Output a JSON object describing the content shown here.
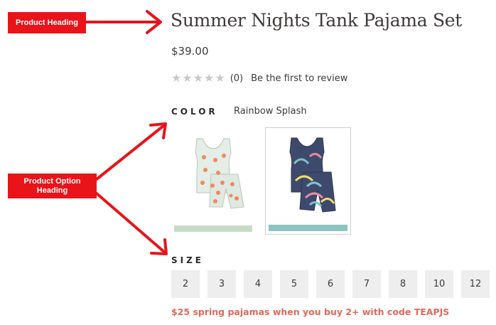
{
  "annotations": {
    "product_heading": "Product Heading",
    "product_option_heading": "Product Option Heading"
  },
  "product": {
    "title": "Summer Nights Tank Pajama Set",
    "price": "$39.00",
    "rating": {
      "stars_filled": 0,
      "stars_total": 5,
      "count": "(0)",
      "review_link": "Be the first to review"
    }
  },
  "color": {
    "heading": "COLOR",
    "selected_value": "Rainbow Splash",
    "swatches": [
      {
        "name": "Orange print",
        "bar_color": "#c6dcc8"
      },
      {
        "name": "Rainbow Splash",
        "bar_color": "#8cc4c0",
        "selected": true
      }
    ]
  },
  "size": {
    "heading": "SIZE",
    "options": [
      "2",
      "3",
      "4",
      "5",
      "6",
      "7",
      "8",
      "10",
      "12"
    ]
  },
  "promo": "$25 spring pajamas when you buy 2+ with code TEAPJS",
  "colors": {
    "annotation_red": "#e8141a",
    "promo_text": "#e5675c",
    "size_button_bg": "#eeeeee"
  }
}
